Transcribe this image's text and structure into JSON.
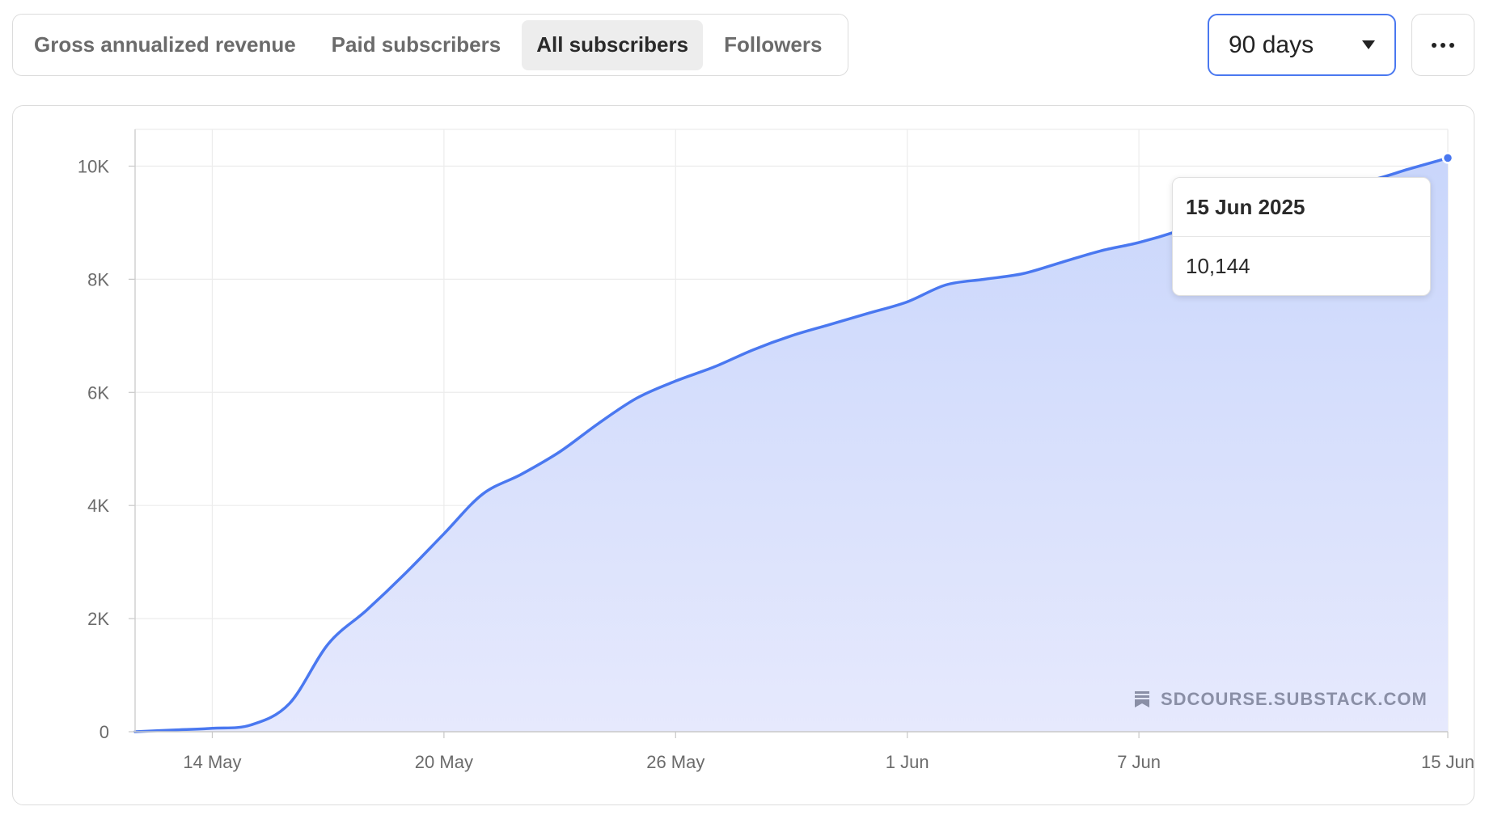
{
  "tabs": [
    {
      "label": "Gross annualized revenue",
      "active": false
    },
    {
      "label": "Paid subscribers",
      "active": false
    },
    {
      "label": "All subscribers",
      "active": true
    },
    {
      "label": "Followers",
      "active": false
    }
  ],
  "range": {
    "selected": "90 days"
  },
  "tooltip": {
    "date": "15 Jun 2025",
    "value": "10,144"
  },
  "watermark": {
    "text": "SDCOURSE.SUBSTACK.COM"
  },
  "colors": {
    "line": "#4a78f0",
    "fill_top": "#c9d6fb",
    "fill_bottom": "#e6e9fd",
    "grid": "#ececec",
    "axis_text": "#6b6b6b"
  },
  "chart_data": {
    "type": "area",
    "x_tick_labels": [
      "14 May",
      "20 May",
      "26 May",
      "1 Jun",
      "7 Jun",
      "15 Jun"
    ],
    "x": [
      "2025-05-12",
      "2025-05-13",
      "2025-05-14",
      "2025-05-15",
      "2025-05-16",
      "2025-05-17",
      "2025-05-18",
      "2025-05-19",
      "2025-05-20",
      "2025-05-21",
      "2025-05-22",
      "2025-05-23",
      "2025-05-24",
      "2025-05-25",
      "2025-05-26",
      "2025-05-27",
      "2025-05-28",
      "2025-05-29",
      "2025-05-30",
      "2025-05-31",
      "2025-06-01",
      "2025-06-02",
      "2025-06-03",
      "2025-06-04",
      "2025-06-05",
      "2025-06-06",
      "2025-06-07",
      "2025-06-08",
      "2025-06-09",
      "2025-06-10",
      "2025-06-11",
      "2025-06-12",
      "2025-06-13",
      "2025-06-14",
      "2025-06-15"
    ],
    "series": [
      {
        "values": [
          0,
          30,
          60,
          120,
          500,
          1550,
          2150,
          2800,
          3500,
          4200,
          4550,
          4950,
          5450,
          5900,
          6200,
          6450,
          6750,
          7000,
          7200,
          7400,
          7600,
          7900,
          8000,
          8100,
          8300,
          8500,
          8650,
          8850,
          9100,
          9300,
          9500,
          9650,
          9750,
          9950,
          10144
        ]
      }
    ],
    "y_tick_labels": [
      "0",
      "2K",
      "4K",
      "6K",
      "8K",
      "10K"
    ],
    "ylim": [
      0,
      10650
    ],
    "grid": true,
    "legend": "none"
  }
}
